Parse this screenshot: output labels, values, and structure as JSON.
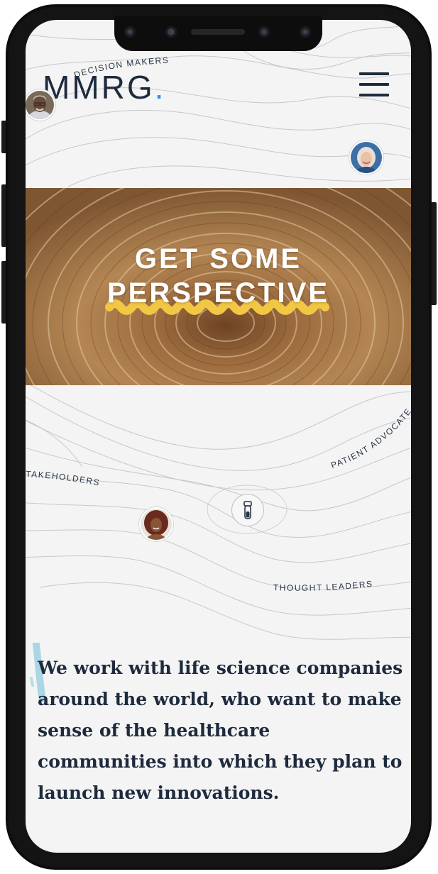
{
  "logo": {
    "text": "MMRG",
    "dot": "."
  },
  "hero": {
    "line1": "GET SOME",
    "line2": "PERSPECTIVE"
  },
  "labels": {
    "decision_makers": "DECISION MAKERS",
    "stakeholders": "TAKEHOLDERS",
    "patient_advocates": "PATIENT ADVOCATES",
    "thought_leaders": "THOUGHT LEADERS"
  },
  "intro": {
    "text": "We work with life science companies around the world, who want to make sense of the healthcare communities into which they plan to launch new innovations."
  },
  "colors": {
    "navy": "#1e2a3d",
    "accent_blue": "#2f8de4",
    "highlight_yellow": "#f2c744",
    "light_blue_stroke": "#9ed1e1",
    "background": "#f4f4f4"
  },
  "icons": {
    "menu": "hamburger-menu-icon",
    "vial": "test-tube-icon"
  }
}
